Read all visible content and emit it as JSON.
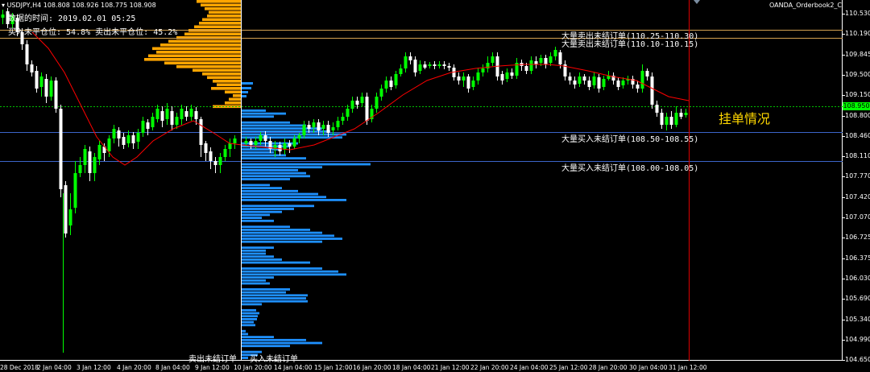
{
  "header": {
    "symbol": "USDJPY,H4",
    "ohlc": "108.808 108.926 108.775 108.908",
    "indicator": "OANDA_Orderbook2_C"
  },
  "info": {
    "data_time": "数据的时间: 2019.02.01 05:25",
    "positions": "买入未平仓位: 54.8%  卖出未平仓位: 45.2%"
  },
  "annotations": {
    "sell_1": "大量卖出未结订单(110.25-110.30)",
    "sell_2": "大量卖出未结订单(110.10-110.15)",
    "buy_1": "大量买入未结订单(108.50-108.55)",
    "buy_2": "大量买入未结订单(108.00-108.05)",
    "callout": "挂单情况"
  },
  "legend": {
    "sell": "卖出未结订单",
    "buy": "买入未结订单"
  },
  "current_price": "108.950",
  "y_axis": [
    "110.530",
    "110.190",
    "109.845",
    "109.500",
    "109.150",
    "108.800",
    "108.460",
    "108.110",
    "107.770",
    "107.420",
    "107.070",
    "106.725",
    "106.375",
    "106.030",
    "105.690",
    "105.340",
    "104.990",
    "104.650"
  ],
  "x_axis": [
    "28 Dec 2018",
    "2 Jan 04:00",
    "3 Jan 12:00",
    "4 Jan 20:00",
    "8 Jan 04:00",
    "9 Jan 12:00",
    "10 Jan 20:00",
    "14 Jan 04:00",
    "15 Jan 12:00",
    "16 Jan 20:00",
    "18 Jan 04:00",
    "21 Jan 12:00",
    "22 Jan 20:00",
    "24 Jan 04:00",
    "25 Jan 12:00",
    "28 Jan 20:00",
    "30 Jan 04:00",
    "31 Jan 12:00"
  ],
  "colors": {
    "up": "#00ff00",
    "down": "#ffffff",
    "ma": "#ff0000",
    "sell_book": "#ffa500",
    "buy_book": "#1e90ff",
    "sell_line": "#d2a050",
    "buy_line": "#3c64c8",
    "cursor_line": "#dc0000"
  }
}
